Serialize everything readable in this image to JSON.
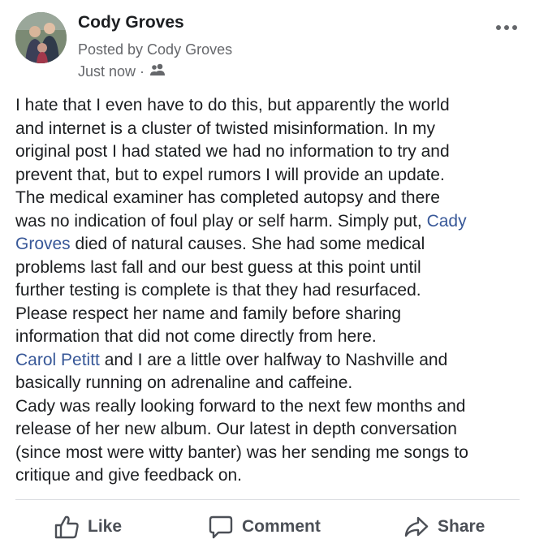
{
  "post": {
    "author": "Cody Groves",
    "posted_by": "Posted by Cody Groves",
    "timestamp": "Just now",
    "separator": "·",
    "audience_icon": "friends-group-icon",
    "more_icon": "more-options-icon",
    "body_lines": [
      "I hate that I even have to do this, but apparently the world",
      "and internet is a cluster of twisted misinformation. In my",
      "original post I had stated we had no information to try and",
      "prevent that, but to expel rumors I will provide an update.",
      "The medical examiner has completed autopsy and there",
      "was no indication of foul play or self harm. Simply put, ",
      "Cady",
      "Groves",
      " died of natural causes. She had some medical",
      "problems last fall and our best guess at this point until",
      "further testing is complete is that they had resurfaced.",
      "Please respect her name and family before sharing",
      "information that did not come directly from here.",
      "Carol Petitt",
      " and I are a little over halfway to Nashville and",
      "basically running on adrenaline and caffeine.",
      "Cady was really looking forward to the next few months and",
      "release of her new album. Our latest in depth conversation",
      "(since most were witty banter) was her sending me songs to",
      "critique and give feedback on."
    ]
  },
  "actions": {
    "like_label": "Like",
    "comment_label": "Comment",
    "share_label": "Share"
  },
  "colors": {
    "mention": "#385898",
    "text": "#1c1e21",
    "secondary": "#65676b",
    "action": "#4b4f56"
  }
}
